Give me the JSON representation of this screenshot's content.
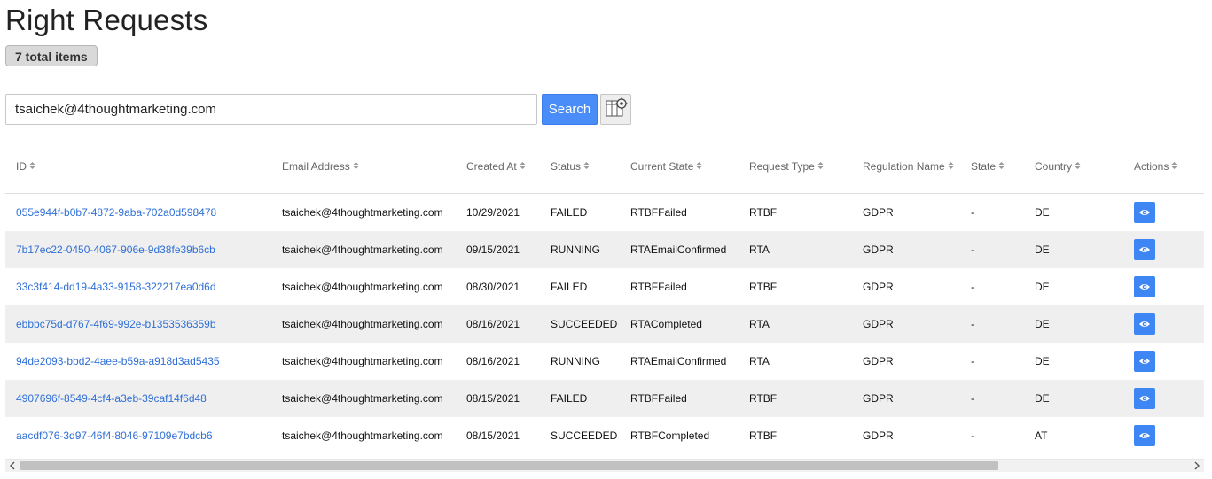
{
  "header": {
    "title": "Right Requests",
    "count_badge": "7 total items"
  },
  "search": {
    "value": "tsaichek@4thoughtmarketing.com",
    "button_label": "Search",
    "columns_icon": "column-settings-icon"
  },
  "table": {
    "columns": [
      "ID",
      "Email Address",
      "Created At",
      "Status",
      "Current State",
      "Request Type",
      "Regulation Name",
      "State",
      "Country",
      "Actions"
    ],
    "rows": [
      {
        "id": "055e944f-b0b7-4872-9aba-702a0d598478",
        "email": "tsaichek@4thoughtmarketing.com",
        "created_at": "10/29/2021",
        "status": "FAILED",
        "current_state": "RTBFFailed",
        "request_type": "RTBF",
        "regulation": "GDPR",
        "state": "-",
        "country": "DE"
      },
      {
        "id": "7b17ec22-0450-4067-906e-9d38fe39b6cb",
        "email": "tsaichek@4thoughtmarketing.com",
        "created_at": "09/15/2021",
        "status": "RUNNING",
        "current_state": "RTAEmailConfirmed",
        "request_type": "RTA",
        "regulation": "GDPR",
        "state": "-",
        "country": "DE"
      },
      {
        "id": "33c3f414-dd19-4a33-9158-322217ea0d6d",
        "email": "tsaichek@4thoughtmarketing.com",
        "created_at": "08/30/2021",
        "status": "FAILED",
        "current_state": "RTBFFailed",
        "request_type": "RTBF",
        "regulation": "GDPR",
        "state": "-",
        "country": "DE"
      },
      {
        "id": "ebbbc75d-d767-4f69-992e-b1353536359b",
        "email": "tsaichek@4thoughtmarketing.com",
        "created_at": "08/16/2021",
        "status": "SUCCEEDED",
        "current_state": "RTACompleted",
        "request_type": "RTA",
        "regulation": "GDPR",
        "state": "-",
        "country": "DE"
      },
      {
        "id": "94de2093-bbd2-4aee-b59a-a918d3ad5435",
        "email": "tsaichek@4thoughtmarketing.com",
        "created_at": "08/16/2021",
        "status": "RUNNING",
        "current_state": "RTAEmailConfirmed",
        "request_type": "RTA",
        "regulation": "GDPR",
        "state": "-",
        "country": "DE"
      },
      {
        "id": "4907696f-8549-4cf4-a3eb-39caf14f6d48",
        "email": "tsaichek@4thoughtmarketing.com",
        "created_at": "08/15/2021",
        "status": "FAILED",
        "current_state": "RTBFFailed",
        "request_type": "RTBF",
        "regulation": "GDPR",
        "state": "-",
        "country": "DE"
      },
      {
        "id": "aacdf076-3d97-46f4-8046-97109e7bdcb6",
        "email": "tsaichek@4thoughtmarketing.com",
        "created_at": "08/15/2021",
        "status": "SUCCEEDED",
        "current_state": "RTBFCompleted",
        "request_type": "RTBF",
        "regulation": "GDPR",
        "state": "-",
        "country": "AT"
      }
    ],
    "action_icon": "eye-icon"
  },
  "colors": {
    "accent": "#4b8df8",
    "link": "#2f6fd6",
    "row_stripe": "#efefef"
  }
}
